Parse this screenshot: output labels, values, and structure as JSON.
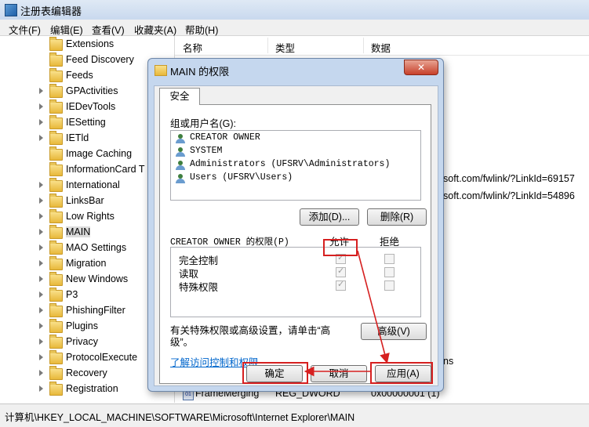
{
  "window": {
    "title": "注册表编辑器"
  },
  "menu": [
    "文件(F)",
    "编辑(E)",
    "查看(V)",
    "收藏夹(A)",
    "帮助(H)"
  ],
  "tree": {
    "items": [
      "Extensions",
      "Feed Discovery",
      "Feeds",
      "GPActivities",
      "IEDevTools",
      "IESetting",
      "IETld",
      "Image Caching",
      "InformationCard T",
      "International",
      "LinksBar",
      "Low Rights",
      "MAIN",
      "MAO Settings",
      "Migration",
      "New Windows",
      "P3",
      "PhishingFilter",
      "Plugins",
      "Privacy",
      "ProtocolExecute",
      "Recovery",
      "Registration"
    ],
    "selected": "MAIN"
  },
  "list": {
    "columns": [
      "名称",
      "类型",
      "数据"
    ],
    "data_fragments": [
      "soft.com/fwlink/?LinkId=69157",
      "soft.com/fwlink/?LinkId=54896",
      "ns"
    ],
    "bottom_row": {
      "name": "FrameMerging",
      "type": "REG_DWORD",
      "data": "0x00000001 (1)"
    }
  },
  "status": {
    "path": "计算机\\HKEY_LOCAL_MACHINE\\SOFTWARE\\Microsoft\\Internet Explorer\\MAIN"
  },
  "dialog": {
    "title": "MAIN 的权限",
    "tab": "安全",
    "group_label": "组或用户名(G):",
    "users": [
      "CREATOR OWNER",
      "SYSTEM",
      "Administrators (UFSRV\\Administrators)",
      "Users (UFSRV\\Users)"
    ],
    "add_button": "添加(D)...",
    "remove_button": "删除(R)",
    "perm_label": "CREATOR OWNER 的权限(P)",
    "allow_header": "允许",
    "deny_header": "拒绝",
    "permissions": [
      {
        "name": "完全控制",
        "allow": true,
        "deny": false
      },
      {
        "name": "读取",
        "allow": true,
        "deny": false
      },
      {
        "name": "特殊权限",
        "allow": true,
        "deny": false
      }
    ],
    "special_text_1": "有关特殊权限或高级设置，请单击“高",
    "special_text_2": "级”。",
    "advanced_button": "高级(V)",
    "link": "了解访问控制和权限",
    "ok_button": "确定",
    "cancel_button": "取消",
    "apply_button": "应用(A)"
  },
  "colors": {
    "highlight": "#d62020",
    "link": "#0066cc"
  }
}
